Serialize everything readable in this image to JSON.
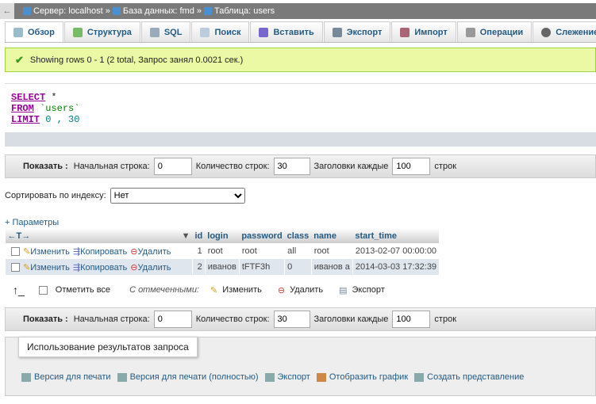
{
  "breadcrumb": {
    "server": "Сервер: localhost",
    "sep": "»",
    "database": "База данных: fmd",
    "table": "Таблица: users"
  },
  "tabs": [
    "Обзор",
    "Структура",
    "SQL",
    "Поиск",
    "Вставить",
    "Экспорт",
    "Импорт",
    "Операции",
    "Слежение"
  ],
  "message": "Showing rows 0 - 1 (2 total, Запрос занял 0.0021 сек.)",
  "sql": {
    "l1a": "SELECT",
    "l1b": " *",
    "l2a": "FROM",
    "l2b": " `users`",
    "l3a": "LIMIT",
    "l3b": " 0 , 30"
  },
  "nav": {
    "show": "Показать :",
    "start_label": "Начальная строка:",
    "start": "0",
    "count_label": "Количество строк:",
    "count": "30",
    "headers_label": "Заголовки каждые",
    "headers": "100",
    "rows_suffix": "строк"
  },
  "sort": {
    "label": "Сортировать по индексу:",
    "value": "Нет"
  },
  "params": "+ Параметры",
  "table": {
    "arrows": "←T→",
    "columns": [
      "id",
      "login",
      "password",
      "class",
      "name",
      "start_time"
    ],
    "actions": {
      "edit": "Изменить",
      "copy": "Копировать",
      "delete": "Удалить"
    },
    "rows": [
      [
        "1",
        "root",
        "root",
        "all",
        "root",
        "2013-02-07 00:00:00"
      ],
      [
        "2",
        "иванов",
        "tFTF3h",
        "0",
        "иванов а",
        "2014-03-03 17:32:39"
      ]
    ]
  },
  "bulk": {
    "check_all": "Отметить все",
    "with_selected": "С отмеченными:",
    "edit": "Изменить",
    "delete": "Удалить",
    "export": "Экспорт"
  },
  "results": {
    "legend": "Использование результатов запроса",
    "links": [
      "Версия для печати",
      "Версия для печати (полностью)",
      "Экспорт",
      "Отобразить график",
      "Создать представление"
    ]
  }
}
